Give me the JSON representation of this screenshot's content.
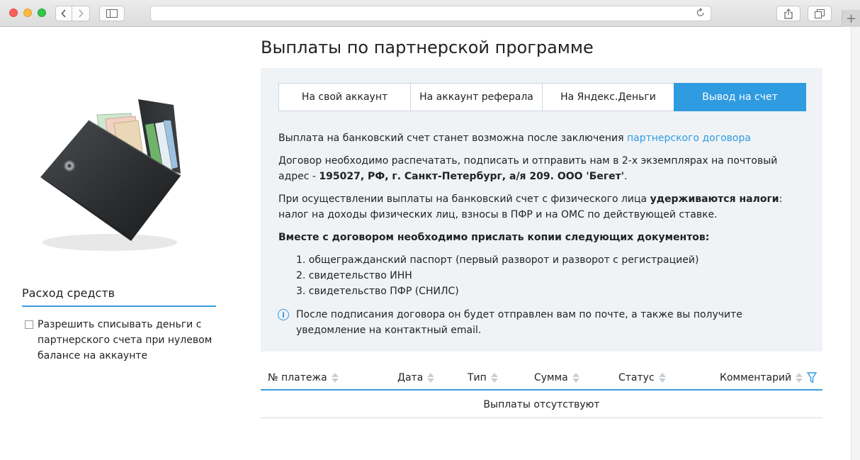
{
  "sidebar": {
    "section_title": "Расход средств",
    "checkbox_label": "Разрешить списывать деньги с партнерского счета при нулевом балансе на аккаунте",
    "checkbox_checked": false
  },
  "main": {
    "title": "Выплаты по партнерской программе",
    "tabs": [
      {
        "label": "На свой аккаунт",
        "active": false
      },
      {
        "label": "На аккаунт реферала",
        "active": false
      },
      {
        "label": "На Яндекс.Деньги",
        "active": false
      },
      {
        "label": "Вывод на счет",
        "active": true
      }
    ],
    "p1_text": "Выплата на банковский счет станет возможна после заключения ",
    "p1_link": "партнерского договора",
    "p2_text": "Договор необходимо распечатать, подписать и отправить нам в 2-х экземплярах на почтовый адрес - ",
    "p2_address": "195027, РФ, г. Санкт-Петербург, а/я 209. ООО 'Бегет'",
    "p2_end": ".",
    "p3_text": "При осуществлении выплаты на банковский счет с физического лица ",
    "p3_bold": "удерживаются налоги",
    "p3_colon": ":",
    "p3_line2": "налог на доходы физических лиц, взносы в ПФР и на ОМС по действующей ставке.",
    "docs_title": "Вместе с договором необходимо прислать копии следующих документов:",
    "docs": [
      "1. общегражданский паспорт (первый разворот и разворот с регистрацией)",
      "2. свидетельство ИНН",
      "3. свидетельство ПФР (СНИЛС)"
    ],
    "info_icon": "i",
    "info_text": "После подписания договора он будет отправлен вам по почте, а также вы получите уведомление на контактный email."
  },
  "table": {
    "columns": [
      "№ платежа",
      "Дата",
      "Тип",
      "Сумма",
      "Статус",
      "Комментарий"
    ],
    "empty_text": "Выплаты отсутствуют"
  },
  "colors": {
    "accent": "#2f9be0",
    "panel_bg": "#eff3f6"
  }
}
